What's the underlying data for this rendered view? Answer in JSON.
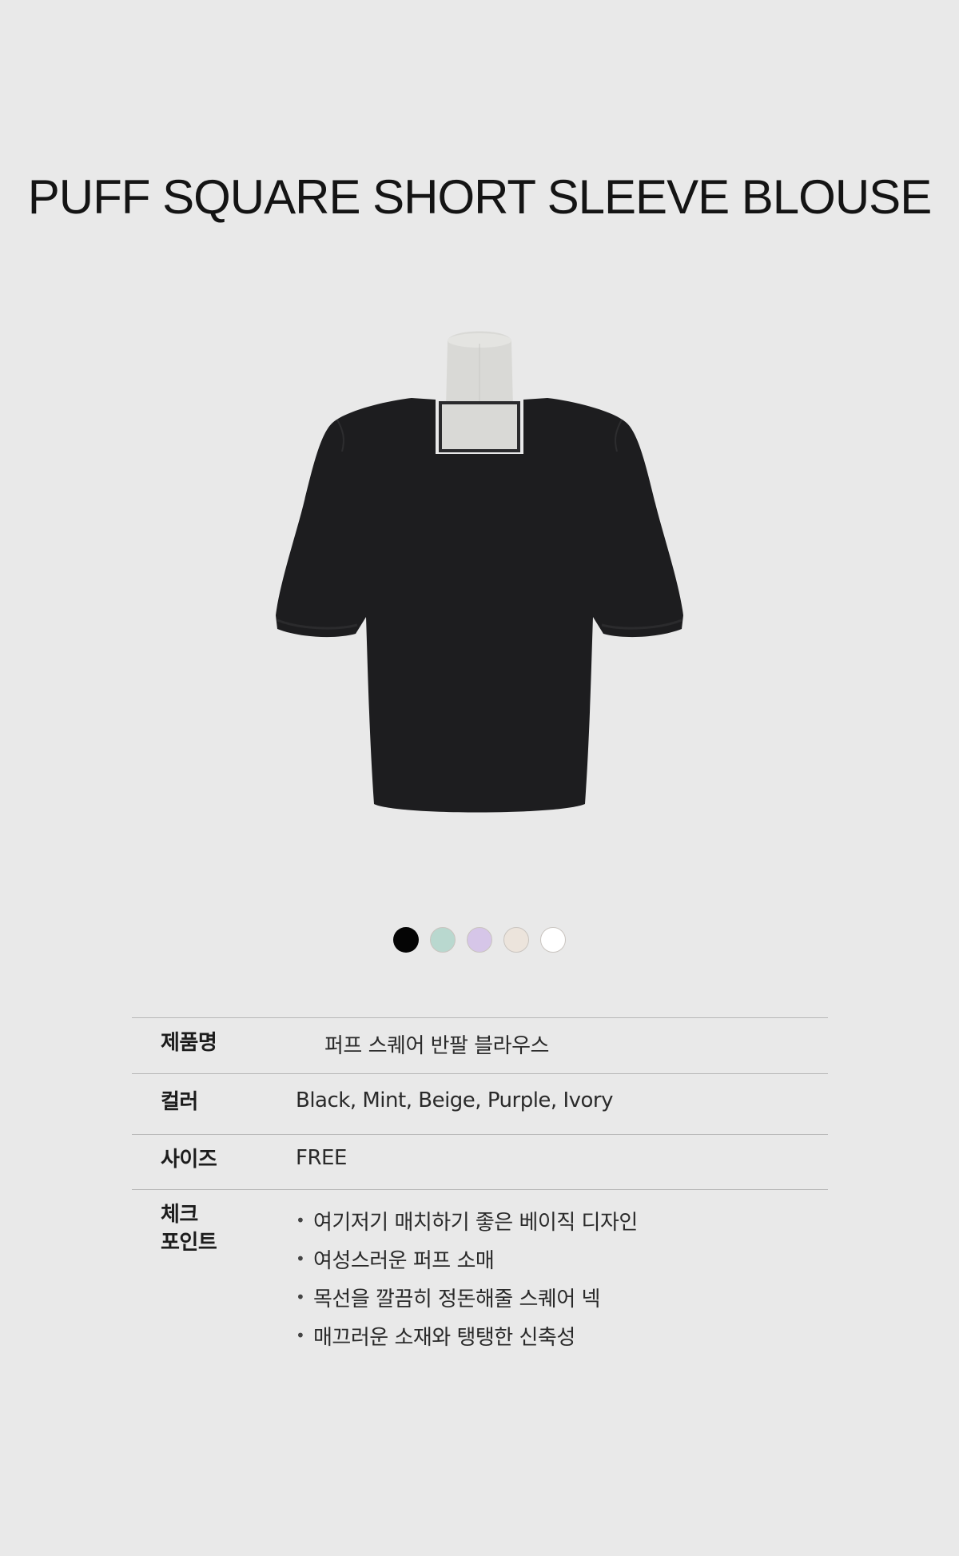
{
  "title": "PUFF SQUARE SHORT SLEEVE BLOUSE",
  "product_image": {
    "subject": "black puff square-neck short sleeve blouse on mannequin",
    "garment_color": "#1d1d1f",
    "mannequin_color": "#d9d9d6"
  },
  "swatches": [
    {
      "name": "Black",
      "color": "#050505"
    },
    {
      "name": "Mint",
      "color": "#b9d8cf"
    },
    {
      "name": "Purple",
      "color": "#d6c6e8"
    },
    {
      "name": "Beige",
      "color": "#ece4dc"
    },
    {
      "name": "Ivory",
      "color": "#ffffff"
    }
  ],
  "info": {
    "name_label": "제품명",
    "name_value": "퍼프 스퀘어 반팔 블라우스",
    "color_label": "컬러",
    "color_value": "Black, Mint, Beige, Purple, Ivory",
    "size_label": "사이즈",
    "size_value": "FREE",
    "points_label_line1": "체크",
    "points_label_line2": "포인트",
    "points": [
      "여기저기 매치하기 좋은 베이직 디자인",
      "여성스러운 퍼프 소매",
      "목선을 깔끔히 정돈해줄 스퀘어 넥",
      "매끄러운 소재와 탱탱한 신축성"
    ],
    "bullet": "•"
  }
}
